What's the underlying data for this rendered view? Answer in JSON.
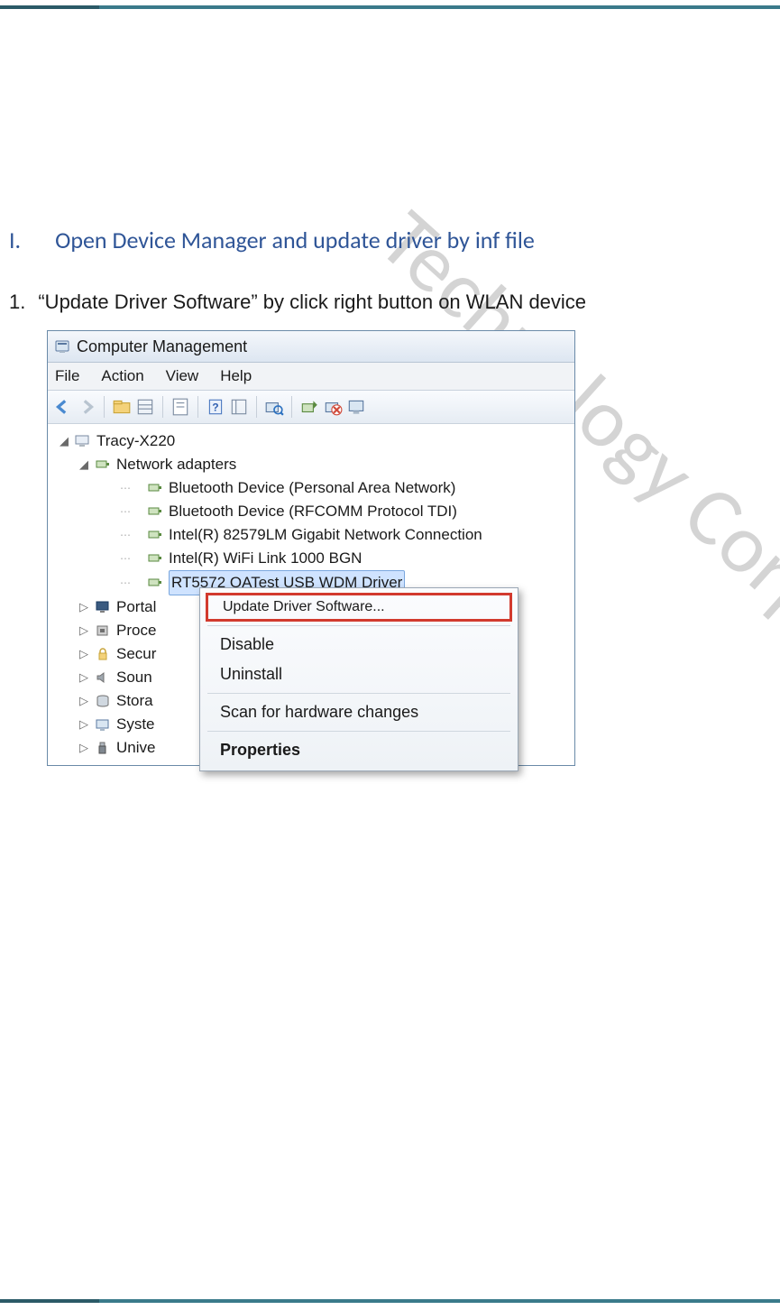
{
  "watermark": "Technology Corporation",
  "heading": {
    "num": "I.",
    "text": "Open Device Manager and update driver by inf file"
  },
  "step1": {
    "num": "1.",
    "text": "“Update Driver Software” by click right button on WLAN device"
  },
  "window": {
    "title": "Computer Management",
    "menu": {
      "file": "File",
      "action": "Action",
      "view": "View",
      "help": "Help"
    }
  },
  "tree": {
    "root": "Tracy-X220",
    "netAdapters": "Network adapters",
    "items": [
      "Bluetooth Device (Personal Area Network)",
      "Bluetooth Device (RFCOMM Protocol TDI)",
      "Intel(R) 82579LM Gigabit Network Connection",
      "Intel(R) WiFi Link 1000 BGN",
      "RT5572 QATest USB WDM Driver"
    ],
    "others": [
      "Portal",
      "Proce",
      "Secur",
      "Soun",
      "Stora",
      "Syste",
      "Unive"
    ]
  },
  "context": {
    "update": "Update Driver Software...",
    "disable": "Disable",
    "uninstall": "Uninstall",
    "scan": "Scan for hardware changes",
    "properties": "Properties"
  }
}
